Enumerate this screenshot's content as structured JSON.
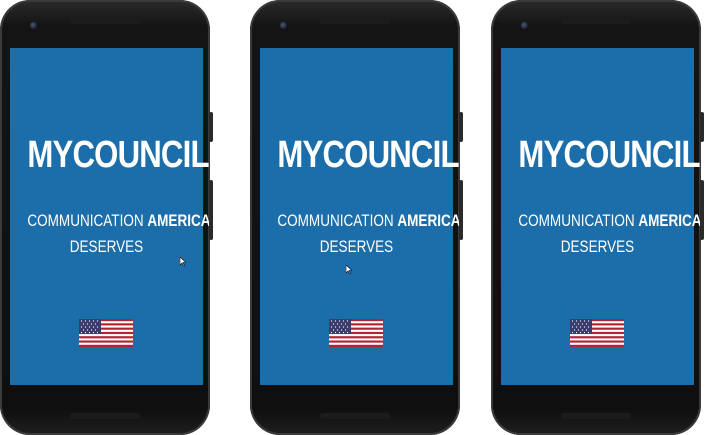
{
  "screens": [
    {
      "app_title": "MYCOUNCIL",
      "tagline_part1": "COMMUNICATION",
      "tagline_strong": "AMERICA",
      "tagline_line2": "DESERVES",
      "flag_icon": "us-flag-icon"
    },
    {
      "app_title": "MYCOUNCIL",
      "tagline_part1": "COMMUNICATION",
      "tagline_strong": "AMERICA",
      "tagline_line2": "DESERVES",
      "flag_icon": "us-flag-icon"
    },
    {
      "app_title": "MYCOUNCIL",
      "tagline_part1": "COMMUNICATION",
      "tagline_strong": "AMERICA",
      "tagline_line2": "DESERVES",
      "flag_icon": "us-flag-icon"
    }
  ],
  "colors": {
    "screen_background": "#1b6ea9",
    "text": "#ffffff",
    "device_frame": "#141414"
  }
}
